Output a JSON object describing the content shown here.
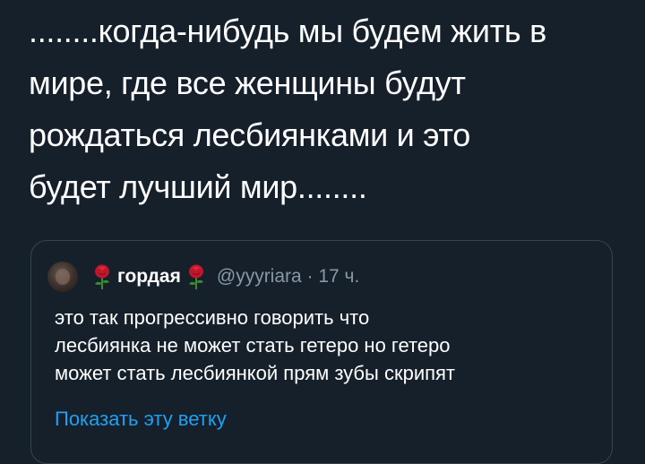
{
  "tweet": {
    "text": "........когда-нибудь мы будем жить в\nмире, где все женщины будут\nрождаться  лесбиянками и это\nбудет лучший мир........"
  },
  "quoted_tweet": {
    "avatar_icon": "user-avatar",
    "emoji_icon": "rose-icon",
    "display_name": "гордая",
    "handle_and_time": "@yyyriara · 17 ч.",
    "text": "это так прогрессивно говорить что\nлесбиянка не может стать гетеро но гетеро\nможет стать лесбиянкой прям зубы скрипят",
    "show_thread_label": "Показать эту ветку"
  },
  "colors": {
    "background": "#15202b",
    "text": "#ffffff",
    "secondary": "#8899a6",
    "link": "#1da1f2",
    "border": "#38444d"
  }
}
